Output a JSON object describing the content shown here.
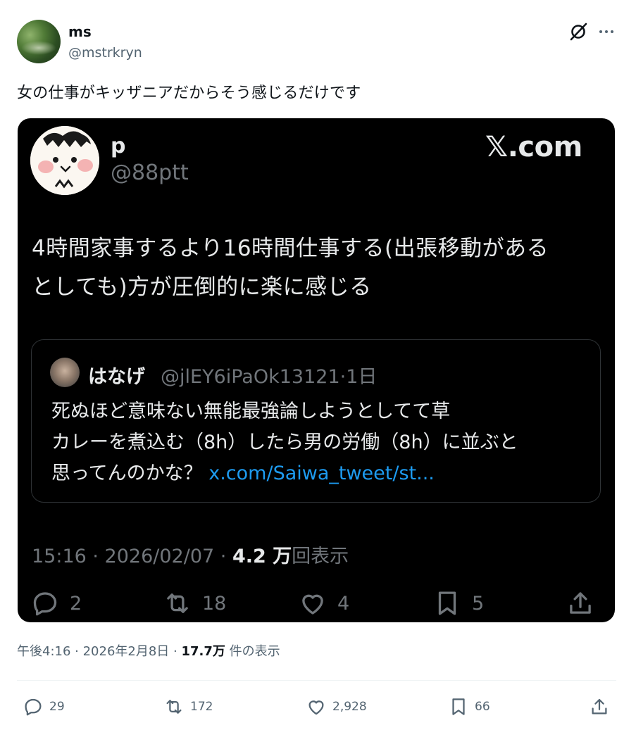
{
  "author": {
    "name": "ms",
    "handle": "@mstrkryn"
  },
  "tweet": {
    "text": "女の仕事がキッザニアだからそう感じるだけです"
  },
  "embedded_post": {
    "name": "p",
    "handle": "@88ptt",
    "logo_text": "𝕏.com",
    "text_line1": "4時間家事するより16時間仕事する(出張移動がある",
    "text_line2": "としても)方が圧倒的に楽に感じる",
    "quote": {
      "name": "はなげ",
      "handle_time": "@jlEY6iPaOk13121·1日",
      "line1": "死ぬほど意味ない無能最強論しようとしてて草",
      "line2": "カレーを煮込む（8h）したら男の労働（8h）に並ぶと",
      "line3": "思ってんのかな？",
      "link": "x.com/Saiwa_tweet/st..."
    },
    "meta_prefix": "15:16 · 2026/02/07 · ",
    "meta_views": "4.2 万",
    "meta_suffix": "回表示",
    "actions": {
      "replies": "2",
      "reposts": "18",
      "likes": "4",
      "bookmarks": "5"
    }
  },
  "meta": {
    "prefix": "午後4:16 · 2026年2月8日 · ",
    "views": "17.7万",
    "suffix": " 件の表示"
  },
  "actions": {
    "replies": "29",
    "reposts": "172",
    "likes": "2,928",
    "bookmarks": "66"
  },
  "icons": [
    "grok-icon",
    "more-icon",
    "reply-icon",
    "repost-icon",
    "like-icon",
    "bookmark-icon",
    "share-icon"
  ]
}
